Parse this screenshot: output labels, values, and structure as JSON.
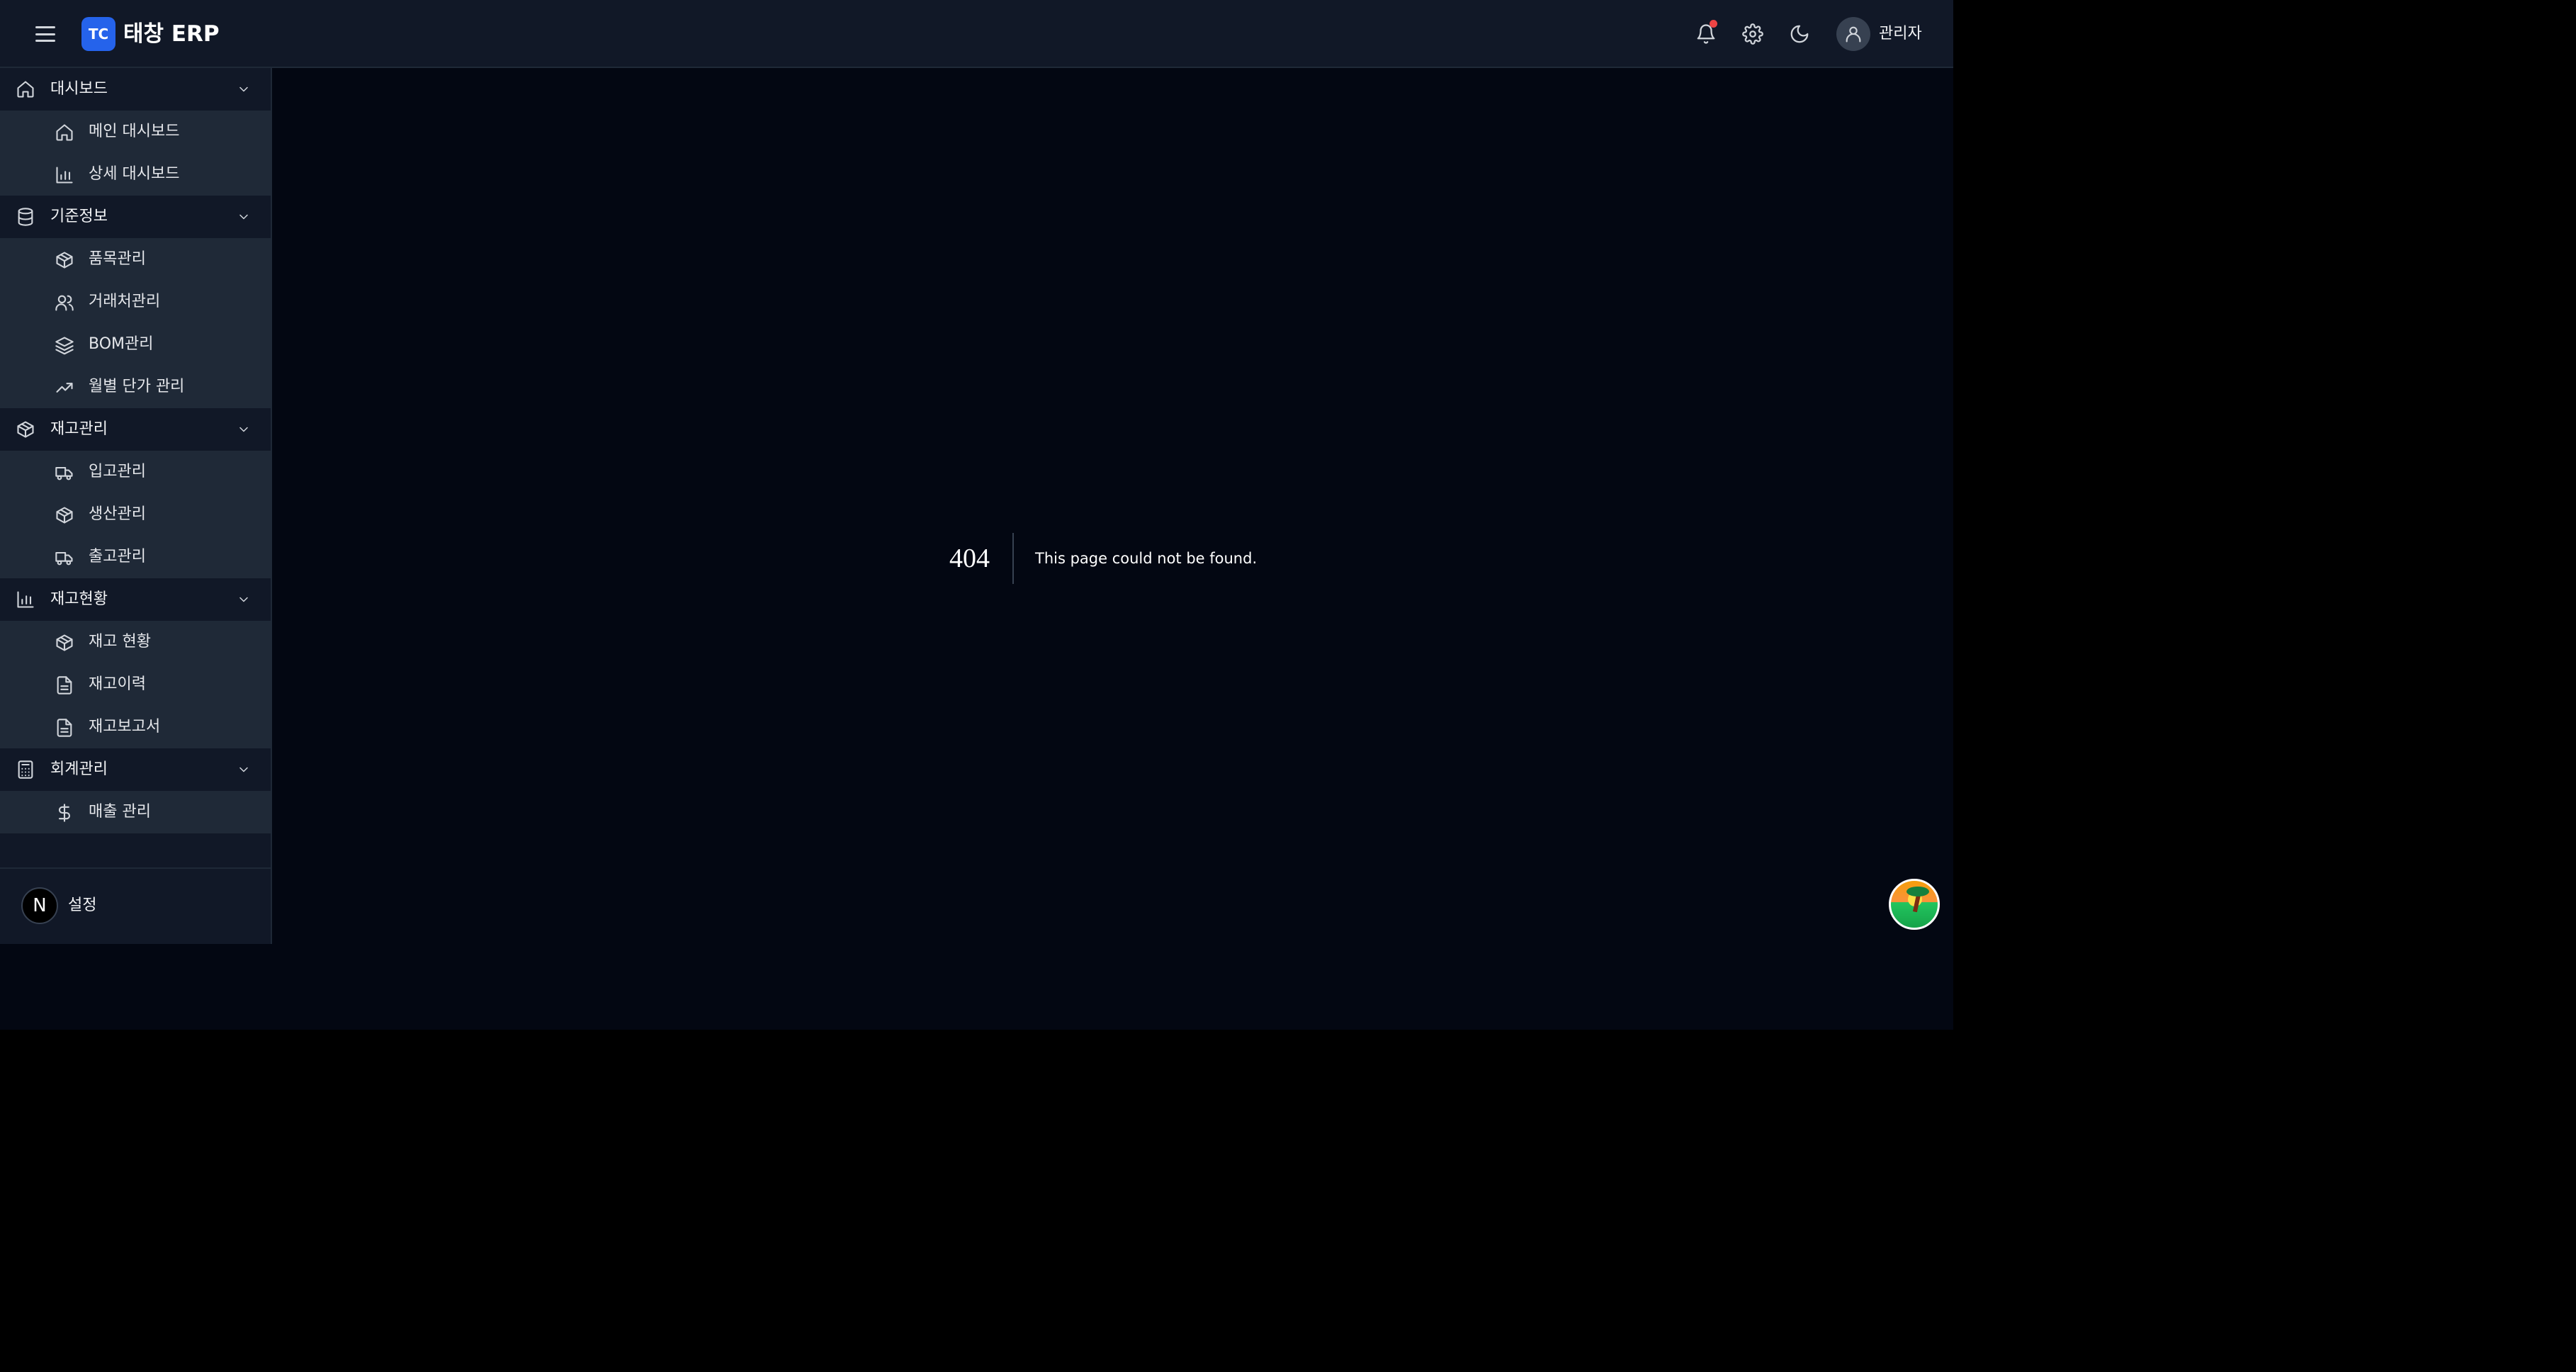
{
  "header": {
    "logo_badge": "TC",
    "brand": "태창 ERP",
    "user_name": "관리자",
    "icons": [
      "menu-icon",
      "bell-icon",
      "gear-icon",
      "moon-icon",
      "user-icon"
    ],
    "notification_dot_color": "#ef4444",
    "accent_color": "#2563eb"
  },
  "sidebar": {
    "groups": [
      {
        "label": "대시보드",
        "icon": "home-icon",
        "items": [
          {
            "label": "메인 대시보드",
            "icon": "home-icon"
          },
          {
            "label": "상세 대시보드",
            "icon": "bar-chart-icon"
          }
        ]
      },
      {
        "label": "기준정보",
        "icon": "database-icon",
        "items": [
          {
            "label": "품목관리",
            "icon": "package-icon"
          },
          {
            "label": "거래처관리",
            "icon": "users-icon"
          },
          {
            "label": "BOM관리",
            "icon": "layers-icon"
          },
          {
            "label": "월별 단가 관리",
            "icon": "trending-up-icon"
          }
        ]
      },
      {
        "label": "재고관리",
        "icon": "package-icon",
        "items": [
          {
            "label": "입고관리",
            "icon": "truck-icon"
          },
          {
            "label": "생산관리",
            "icon": "package-icon"
          },
          {
            "label": "출고관리",
            "icon": "truck-icon"
          }
        ]
      },
      {
        "label": "재고현황",
        "icon": "bar-chart-icon",
        "items": [
          {
            "label": "재고 현황",
            "icon": "package-icon"
          },
          {
            "label": "재고이력",
            "icon": "file-text-icon"
          },
          {
            "label": "재고보고서",
            "icon": "file-text-icon"
          }
        ]
      },
      {
        "label": "회계관리",
        "icon": "calculator-icon",
        "items": [
          {
            "label": "매출 관리",
            "icon": "dollar-icon"
          }
        ]
      }
    ],
    "footer": {
      "badge": "N",
      "label": "설정"
    }
  },
  "main": {
    "error_code": "404",
    "error_message": "This page could not be found."
  }
}
